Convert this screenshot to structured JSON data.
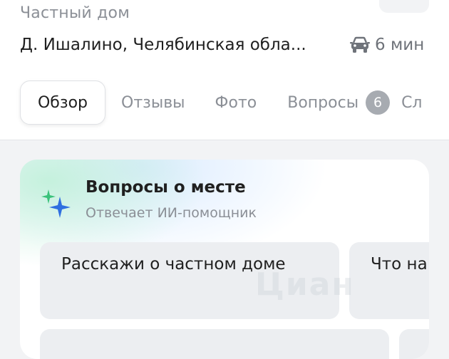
{
  "header": {
    "category": "Частный дом",
    "address": "Д. Ишалино, Челябинская обла...",
    "travel": {
      "icon": "car-icon",
      "time": "6 мин"
    }
  },
  "tabs": [
    {
      "label": "Обзор",
      "active": true
    },
    {
      "label": "Отзывы",
      "active": false
    },
    {
      "label": "Фото",
      "active": false
    },
    {
      "label": "Вопросы",
      "active": false,
      "badge": "6"
    },
    {
      "label": "Сл",
      "active": false
    }
  ],
  "ai_block": {
    "icon": "sparkle-icon",
    "title": "Вопросы о месте",
    "subtitle": "Отвечает ИИ-помощник",
    "suggestions": [
      "Расскажи о частном доме",
      "Что на"
    ],
    "watermark": "Циан"
  },
  "colors": {
    "page_background": "#f2f3f5",
    "muted_text": "#8b8f96",
    "badge": "#a7abb1",
    "chip_background": "#eceef1",
    "sparkle_green": "#3ac27a",
    "sparkle_blue": "#2f6fe0"
  }
}
